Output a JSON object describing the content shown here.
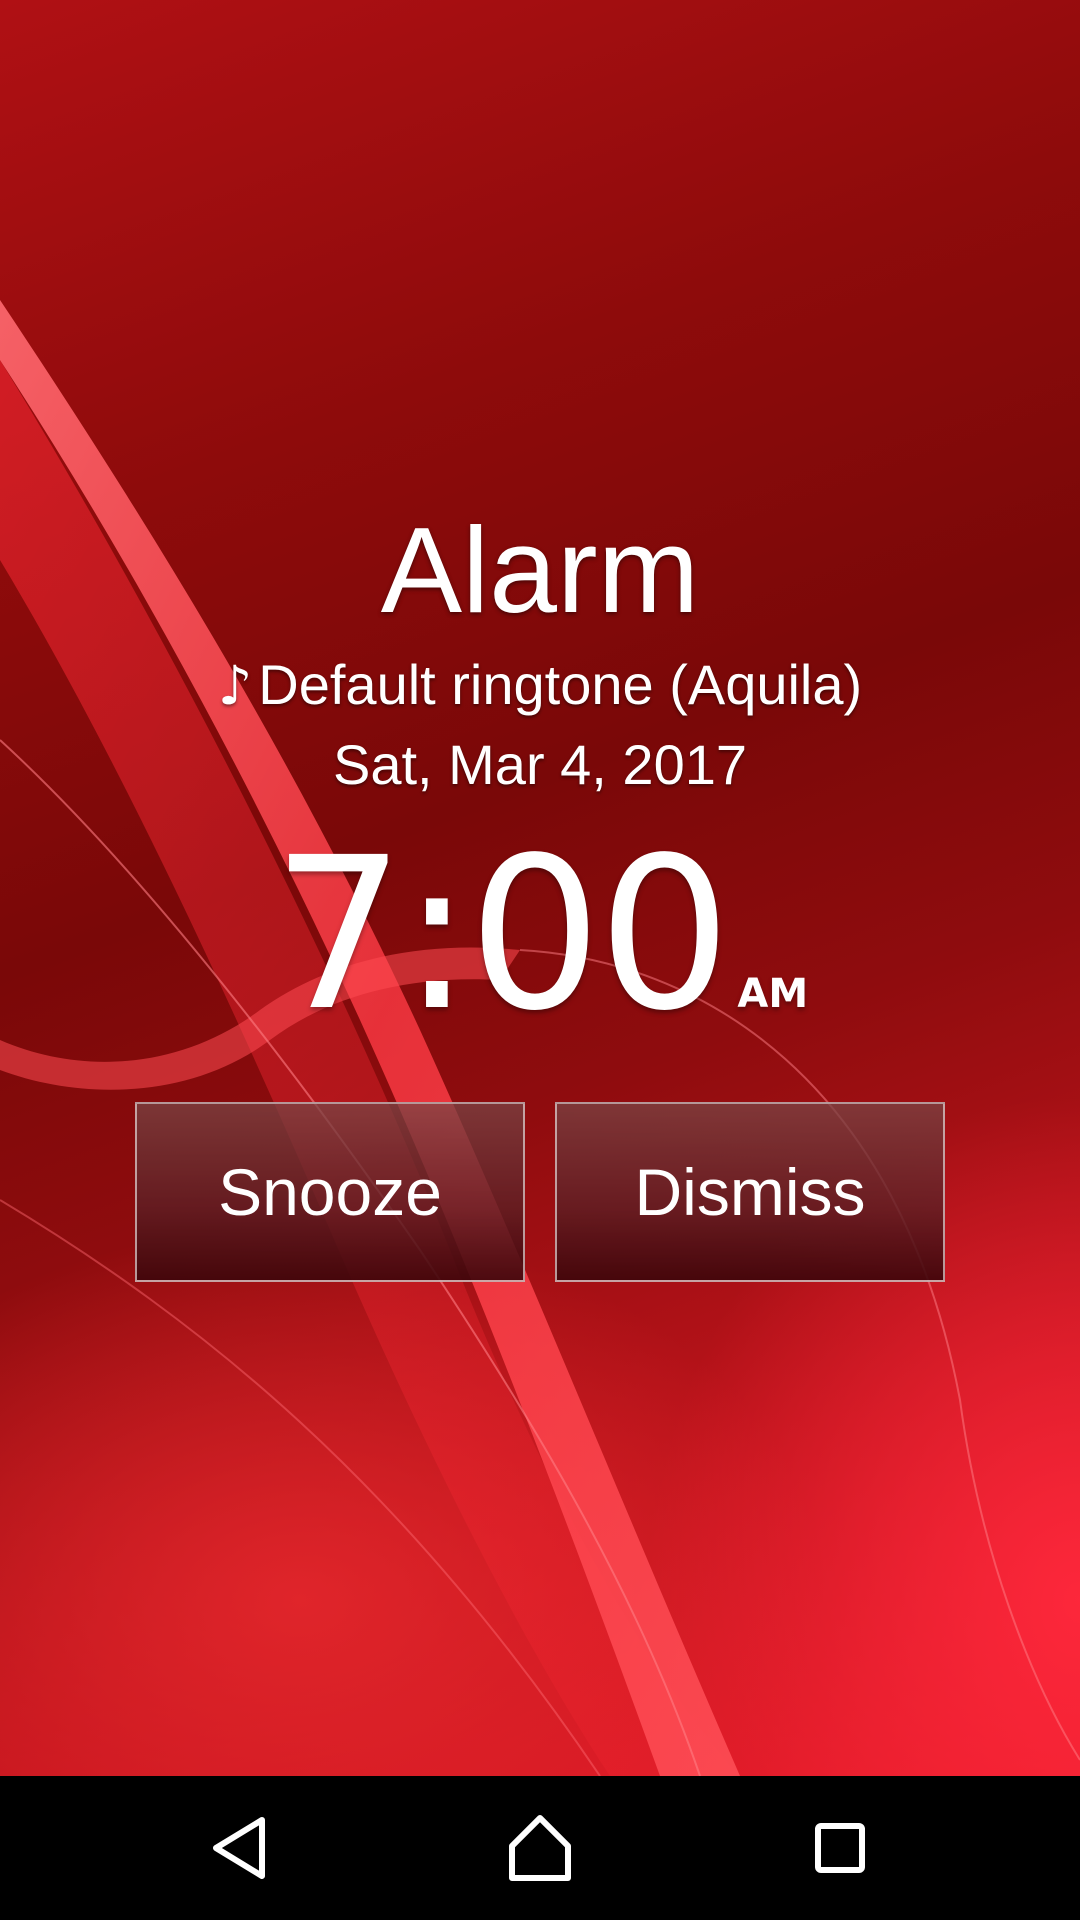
{
  "alarm": {
    "title": "Alarm",
    "ringtone_icon": "music-note-icon",
    "ringtone_glyph": "♪",
    "ringtone": "Default ringtone (Aquila)",
    "date": "Sat, Mar 4, 2017",
    "time": "7:00",
    "ampm": "AM"
  },
  "actions": {
    "snooze_label": "Snooze",
    "dismiss_label": "Dismiss"
  },
  "navbar": {
    "back_icon": "back-icon",
    "home_icon": "home-icon",
    "recents_icon": "recents-icon"
  },
  "colors": {
    "wallpaper_dark": "#7a0808",
    "wallpaper_bright": "#e81c2a",
    "text": "#ffffff",
    "navbar": "#000000"
  }
}
